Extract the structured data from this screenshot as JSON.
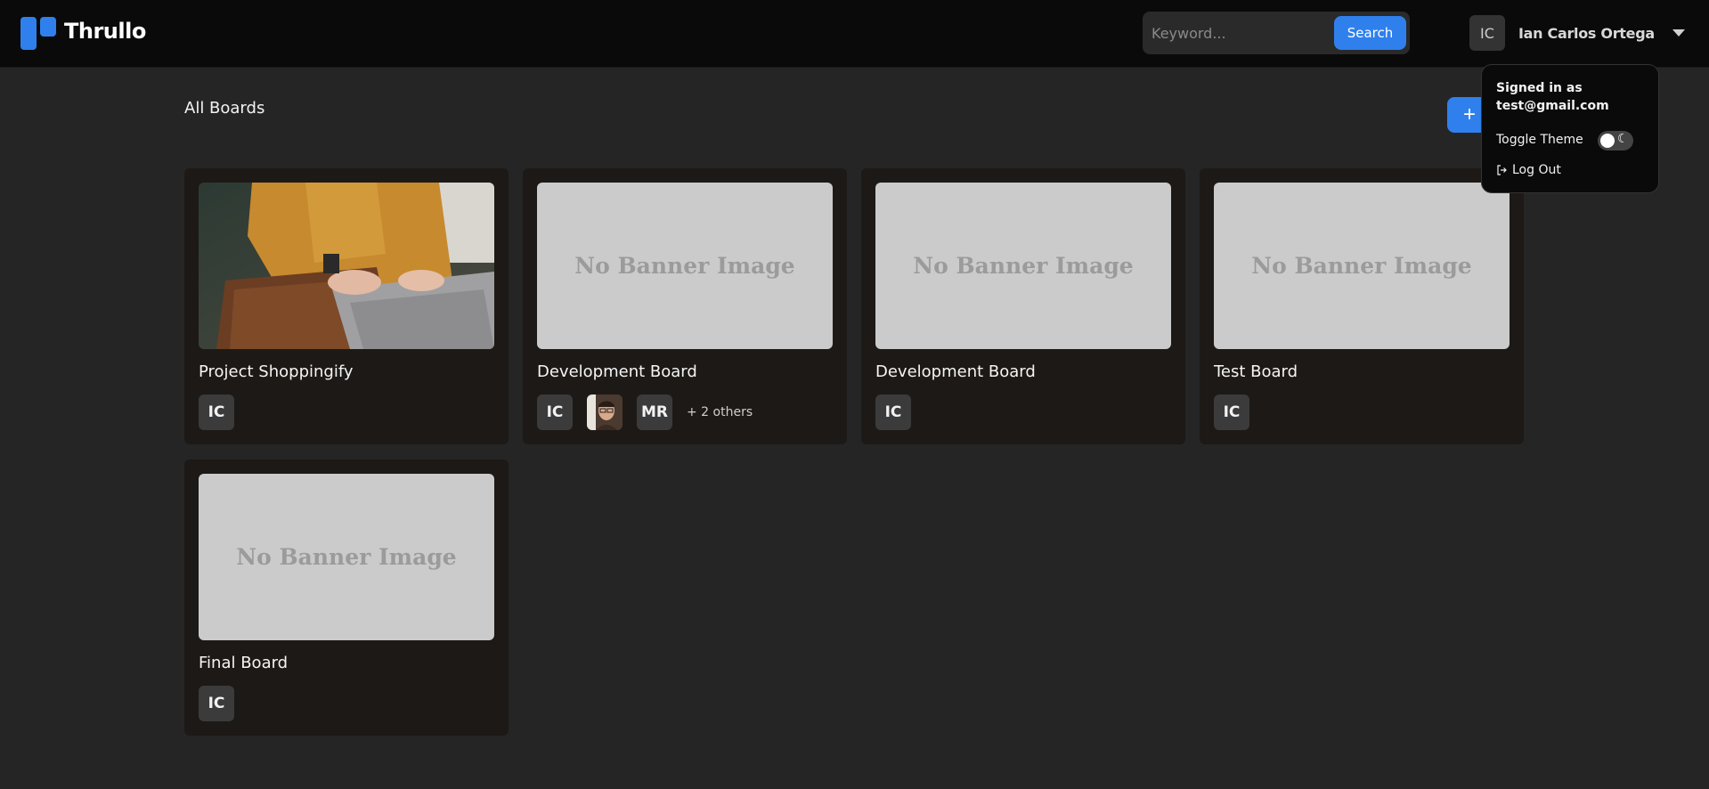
{
  "app": {
    "name": "Thrullo"
  },
  "search": {
    "placeholder": "Keyword...",
    "button_label": "Search"
  },
  "user": {
    "initials": "IC",
    "name": "Ian Carlos Ortega"
  },
  "page": {
    "title": "All Boards",
    "add_button": "+"
  },
  "dropdown": {
    "signed_in_label": "Signed in as",
    "email": "test@gmail.com",
    "toggle_theme_label": "Toggle Theme",
    "logout_label": "Log Out"
  },
  "boards": [
    {
      "title": "Project Shoppingify",
      "banner": "image",
      "members": [
        "IC"
      ],
      "others": ""
    },
    {
      "title": "Development Board",
      "banner": "No Banner Image",
      "members": [
        "IC",
        "photo",
        "MR"
      ],
      "others": "+  2 others"
    },
    {
      "title": "Development Board",
      "banner": "No Banner Image",
      "members": [
        "IC"
      ],
      "others": ""
    },
    {
      "title": "Test Board",
      "banner": "No Banner Image",
      "members": [
        "IC"
      ],
      "others": ""
    },
    {
      "title": "Final Board",
      "banner": "No Banner Image",
      "members": [
        "IC"
      ],
      "others": ""
    }
  ],
  "colors": {
    "accent": "#2f80ed",
    "background": "#252525",
    "card": "#1d1916",
    "topbar": "#0a0a0a"
  }
}
